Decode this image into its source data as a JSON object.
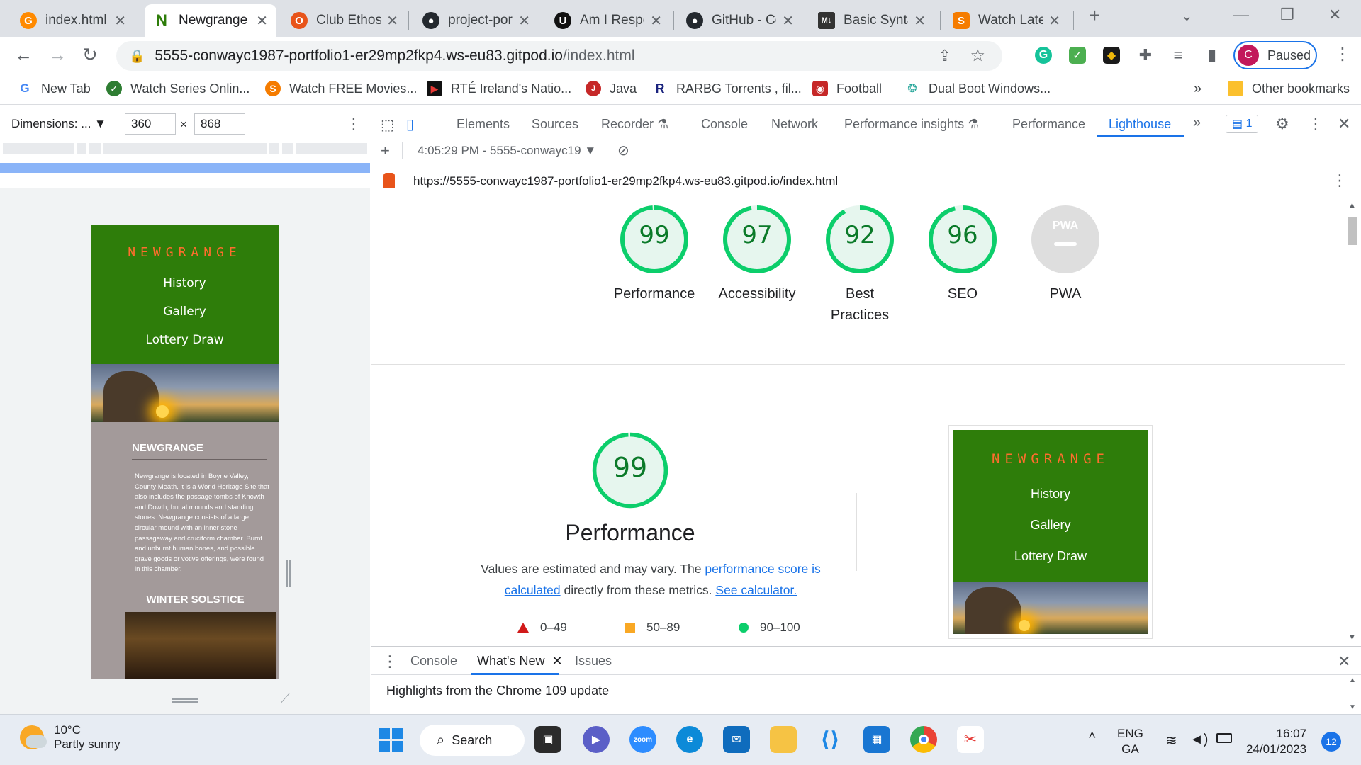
{
  "browser": {
    "tabs": [
      {
        "title": "index.html",
        "icon": "gitpod-icon",
        "color": "#ff8a00",
        "active": false
      },
      {
        "title": "Newgrange",
        "icon": "newgrange-n-icon",
        "color": "#2e7d0a",
        "active": true
      },
      {
        "title": "Club Ethos",
        "icon": "club-ethos-icon",
        "color": "#e8541a",
        "active": false
      },
      {
        "title": "project-por",
        "icon": "github-icon",
        "color": "#24292f",
        "active": false
      },
      {
        "title": "Am I Respo",
        "icon": "amiresponsive-icon",
        "color": "#111111",
        "active": false
      },
      {
        "title": "GitHub - Co",
        "icon": "github-icon",
        "color": "#24292f",
        "active": false
      },
      {
        "title": "Basic Synta",
        "icon": "markdown-icon",
        "color": "#333333",
        "active": false
      },
      {
        "title": "Watch Late",
        "icon": "watch-s-icon",
        "color": "#f57c00",
        "active": false
      }
    ],
    "new_tab_label": "+",
    "address": {
      "url_host": "5555-conwayc1987-portfolio1-er29mp2fkp4.ws-eu83.gitpod.io",
      "url_path": "/index.html"
    },
    "profile": {
      "initial": "C",
      "label": "Paused"
    },
    "bookmarks": [
      {
        "label": "New Tab",
        "icon": "google-icon",
        "color": "#4285f4"
      },
      {
        "label": "Watch Series Onlin...",
        "icon": "shield-check-icon",
        "color": "#2e7d32"
      },
      {
        "label": "Watch FREE Movies...",
        "icon": "watch-s-icon",
        "color": "#f57c00"
      },
      {
        "label": "RTÉ Ireland's Natio...",
        "icon": "rte-play-icon",
        "color": "#b71c1c"
      },
      {
        "label": "Java",
        "icon": "java-icon",
        "color": "#c62828"
      },
      {
        "label": "RARBG Torrents , fil...",
        "icon": "rarbg-r-icon",
        "color": "#1a237e"
      },
      {
        "label": "Football",
        "icon": "football-icon",
        "color": "#c62828"
      },
      {
        "label": "Dual Boot Windows...",
        "icon": "dual-boot-icon",
        "color": "#26a69a"
      }
    ],
    "bookmarks_more": "»",
    "other_bookmarks": "Other bookmarks"
  },
  "device_toolbar": {
    "dimensions_label": "Dimensions: ...",
    "width": "360",
    "height": "868",
    "times": "×"
  },
  "mobile_site": {
    "logo": "NEWGRANGE",
    "nav": [
      "History",
      "Gallery",
      "Lottery Draw"
    ],
    "section_title": "NEWGRANGE",
    "body": "Newgrange is located in Boyne Valley, County Meath, it is a World Heritage Site that also includes the passage tombs of Knowth and Dowth, burial mounds and standing stones. Newgrange consists of a large circular mound with an inner stone passageway and cruciform chamber. Burnt and unburnt human bones, and possible grave goods or votive offerings, were found in this chamber.",
    "solstice_title": "WINTER SOLSTICE"
  },
  "devtools": {
    "tabs": [
      "Elements",
      "Sources",
      "Recorder",
      "Console",
      "Network",
      "Performance insights",
      "Performance",
      "Lighthouse"
    ],
    "more": "»",
    "issues_count": "1",
    "report_label": "4:05:29 PM - 5555-conwayc19",
    "report_url": "https://5555-conwayc1987-portfolio1-er29mp2fkp4.ws-eu83.gitpod.io/index.html"
  },
  "lighthouse": {
    "scores": [
      {
        "label_1": "Performance",
        "label_2": "",
        "value": "99",
        "fraction": 0.99
      },
      {
        "label_1": "Accessibility",
        "label_2": "",
        "value": "97",
        "fraction": 0.97
      },
      {
        "label_1": "Best",
        "label_2": "Practices",
        "value": "92",
        "fraction": 0.92
      },
      {
        "label_1": "SEO",
        "label_2": "",
        "value": "96",
        "fraction": 0.96
      }
    ],
    "pwa_label": "PWA",
    "pwa_badge": "PWA",
    "score_color": "#0cce6b",
    "score_text_color": "#0b7a29",
    "performance": {
      "score": "99",
      "fraction": 0.99,
      "title": "Performance",
      "desc_1": "Values are estimated and may vary. The ",
      "link_1": "performance score is calculated",
      "desc_2": " directly from these metrics. ",
      "link_2": "See calculator."
    },
    "legend": {
      "red": "0–49",
      "orange": "50–89",
      "green": "90–100"
    }
  },
  "drawer": {
    "tabs": [
      "Console",
      "What's New",
      "Issues"
    ],
    "content": "Highlights from the Chrome 109 update"
  },
  "taskbar": {
    "temperature": "10°C",
    "weather": "Partly sunny",
    "search_label": "Search",
    "language_1": "ENG",
    "language_2": "GA",
    "time": "16:07",
    "date": "24/01/2023",
    "notifications": "12"
  }
}
